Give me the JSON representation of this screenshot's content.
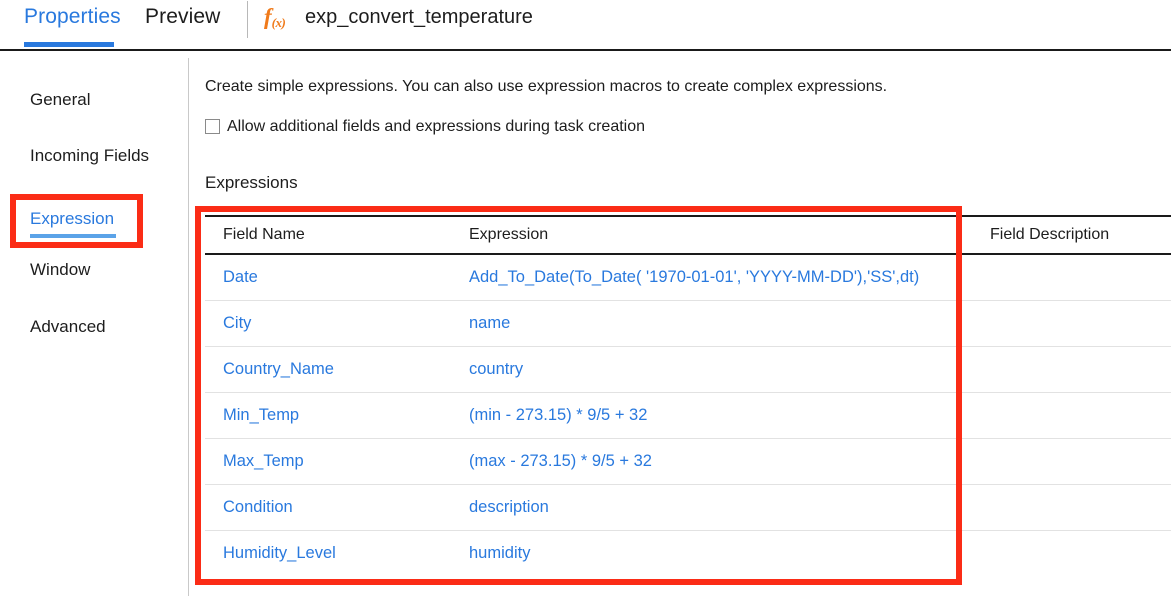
{
  "colors": {
    "accent_blue": "#2979de",
    "annotation_red": "#fb2c16",
    "fx_orange": "#f07a1a",
    "text_dark": "#1d1d1d",
    "underline_light_blue": "#5ba3e8"
  },
  "tabbar": {
    "tabs": [
      {
        "label": "Properties",
        "selected": true
      },
      {
        "label": "Preview",
        "selected": false
      }
    ],
    "fx_icon": {
      "glyph": "f",
      "subscript": "(x)",
      "name": "function-icon"
    },
    "document_title": "exp_convert_temperature"
  },
  "sidebar": {
    "items": [
      {
        "label": "General",
        "selected": false
      },
      {
        "label": "Incoming Fields",
        "selected": false
      },
      {
        "label": "Expression",
        "selected": true
      },
      {
        "label": "Window",
        "selected": false
      },
      {
        "label": "Advanced",
        "selected": false
      }
    ]
  },
  "main": {
    "intro_text": "Create simple expressions. You can also use expression macros to create complex expressions.",
    "allow_additional": {
      "label": "Allow additional fields and expressions during task creation",
      "checked": false
    },
    "section_heading": "Expressions",
    "table": {
      "columns": [
        "Field Name",
        "Expression",
        "Field Description"
      ],
      "rows": [
        {
          "field_name": "Date",
          "expression": "Add_To_Date(To_Date( '1970-01-01', 'YYYY-MM-DD'),'SS',dt)",
          "field_description": ""
        },
        {
          "field_name": "City",
          "expression": "name",
          "field_description": ""
        },
        {
          "field_name": "Country_Name",
          "expression": "country",
          "field_description": ""
        },
        {
          "field_name": "Min_Temp",
          "expression": "(min - 273.15) * 9/5 + 32",
          "field_description": ""
        },
        {
          "field_name": "Max_Temp",
          "expression": "(max - 273.15) * 9/5 + 32",
          "field_description": ""
        },
        {
          "field_name": "Condition",
          "expression": "description",
          "field_description": ""
        },
        {
          "field_name": "Humidity_Level",
          "expression": "humidity",
          "field_description": ""
        }
      ]
    }
  }
}
